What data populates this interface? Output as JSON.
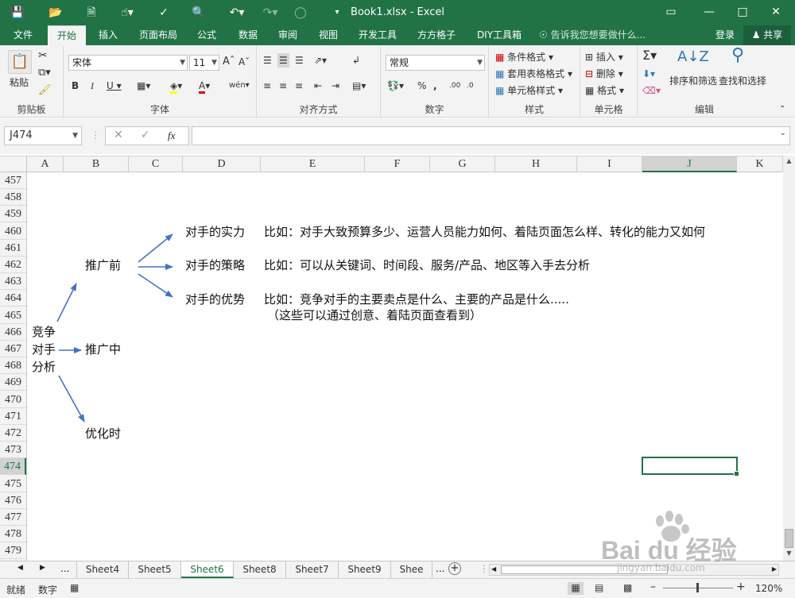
{
  "window": {
    "title": "Book1.xlsx  -  Excel"
  },
  "ribbon_tabs": [
    "文件",
    "开始",
    "插入",
    "页面布局",
    "公式",
    "数据",
    "审阅",
    "视图",
    "开发工具",
    "方方格子",
    "DIY工具箱"
  ],
  "tell_me": "告诉我您想要做什么...",
  "account": {
    "login": "登录",
    "share": "共享"
  },
  "clipboard": {
    "paste": "粘贴",
    "label": "剪贴板"
  },
  "font": {
    "name": "宋体",
    "size": "11",
    "label": "字体"
  },
  "alignment": {
    "label": "对齐方式"
  },
  "number": {
    "format": "常规",
    "label": "数字"
  },
  "styles": {
    "cond": "条件格式",
    "table": "套用表格格式",
    "cell": "单元格样式",
    "label": "样式"
  },
  "cells": {
    "insert": "插入",
    "delete": "删除",
    "format": "格式",
    "label": "单元格"
  },
  "editing": {
    "sort": "排序和筛选",
    "find": "查找和选择",
    "label": "编辑"
  },
  "formula": {
    "namebox": "J474",
    "fx": "fx"
  },
  "columns": [
    "A",
    "B",
    "C",
    "D",
    "E",
    "F",
    "G",
    "H",
    "I",
    "J",
    "K"
  ],
  "selected_col": "J",
  "rows": [
    "457",
    "458",
    "459",
    "460",
    "461",
    "462",
    "463",
    "464",
    "465",
    "466",
    "467",
    "468",
    "469",
    "470",
    "471",
    "472",
    "473",
    "474",
    "475",
    "476",
    "477",
    "478",
    "479"
  ],
  "selected_row": "474",
  "content": {
    "root_line1": "竞争",
    "root_line2": "对手",
    "root_line3": "分析",
    "before": "推广前",
    "during": "推广中",
    "optimize": "优化时",
    "item1_title": "对手的实力",
    "item1_desc": "比如：对手大致预算多少、运营人员能力如何、着陆页面怎么样、转化的能力又如何",
    "item2_title": "对手的策略",
    "item2_desc": "比如：可以从关键词、时间段、服务/产品、地区等入手去分析",
    "item3_title": "对手的优势",
    "item3_desc": "比如：竞争对手的主要卖点是什么、主要的产品是什么.....",
    "item3_note": "（这些可以通过创意、着陆页面查看到）"
  },
  "sheets": [
    "Sheet4",
    "Sheet5",
    "Sheet6",
    "Sheet8",
    "Sheet7",
    "Sheet9",
    "Shee"
  ],
  "active_sheet": "Sheet6",
  "status": {
    "ready": "就绪",
    "mode": "数字",
    "zoom": "120%"
  },
  "watermark": {
    "logo": "Bai du 经验",
    "url": "jingyan.baidu.com"
  },
  "colors": {
    "excel_green": "#217346",
    "arrow": "#4472c4"
  }
}
